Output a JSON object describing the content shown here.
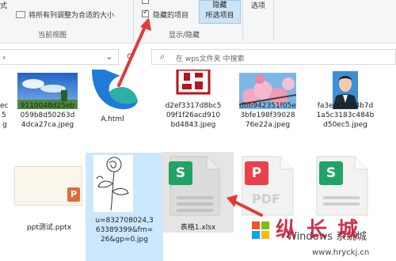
{
  "ribbon": {
    "left_truncated_text": "式",
    "fit_columns_label": "将所有列调整为合适的大小",
    "current_view_label": "当前视图",
    "hidden_items_label": "隐藏的项目",
    "hidden_items_checked": true,
    "hide_selected_line1": "隐藏",
    "hide_selected_line2": "所选项目",
    "show_hide_label": "显示/隐藏",
    "options_label": "选项"
  },
  "nav": {
    "search_placeholder": "在 wps文件夹 中搜索"
  },
  "files": {
    "f0": {
      "line1": "ec",
      "line2": "5",
      "line3": "g"
    },
    "f1": {
      "line1": "9110048d25eb",
      "line2": "059b8d50263d",
      "line3": "4dca27ca.jpeg"
    },
    "f2": {
      "line1": "A.html"
    },
    "f3": {
      "line1": "d2ef3317d8bc5",
      "line2": "09f1f26acd910",
      "line3": "bd4843.jpeg"
    },
    "f4": {
      "line1": "dbb942351f05e",
      "line2": "3bfe198f39028",
      "line3": "76e22a.jpeg"
    },
    "f5": {
      "line1": "fa3eec8834b7d",
      "line2": "1a5c3183c484b",
      "line3": "d50ec5.jpeg"
    },
    "f6": {
      "line1": "ppt测试.pptx"
    },
    "f7": {
      "line1": "u=832708024,3",
      "line2": "63389399&fm=",
      "line3": "26&gp=0.jpg"
    },
    "f8": {
      "line1": "表格1.xlsx"
    }
  },
  "icon_text": {
    "excel_letter": "S",
    "pdf_letter": "P",
    "pdf_word": "PDF",
    "ppt_letter": "P",
    "green_letter": "S"
  },
  "watermark": {
    "text": "Windows 系统城",
    "url": "www.hryckj.cn",
    "big": "纵 长 城"
  },
  "colors": {
    "annotation_red": "#e23b3b",
    "selection_blue": "#cce8ff",
    "excel_green": "#21a366",
    "pdf_red": "#e8414b",
    "ppt_orange": "#e26b3b"
  }
}
